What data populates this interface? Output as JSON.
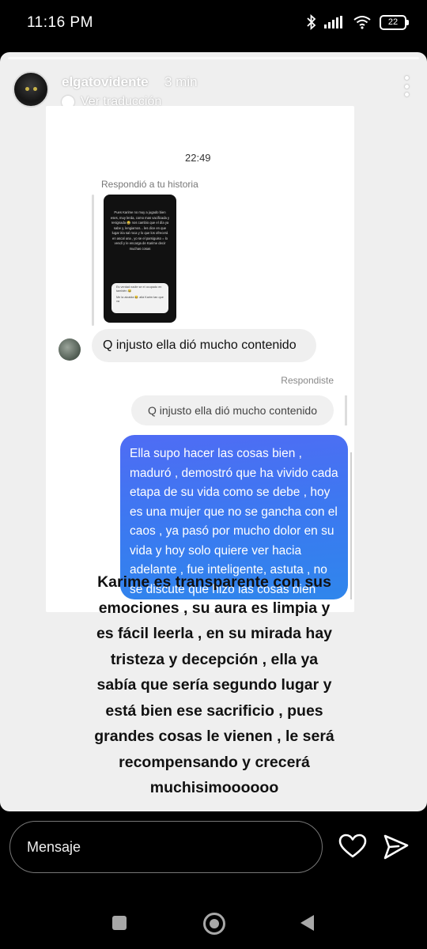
{
  "status_bar": {
    "time": "11:16 PM",
    "battery": "22"
  },
  "story": {
    "username": "elgatovidente",
    "time_ago": "3 min",
    "translate_label": "Ver traducción"
  },
  "chat": {
    "time": "22:49",
    "replied_to_story_label": "Respondió a tu historia",
    "story_thumbnail_text": "Pues Karime no muy a jugado bien eses, muy lerda, como mas vacificada y resignada 😂 nos cambio que el día ya sabe y, lengiamos... les dice en que lugar iria sal roca y lo que los ofrecerá en ascal una , yo se el parsiguiso = lo vendí y le encarga de Karime decir muchas cosas",
    "story_thumbnail_card": [
      "Es verdad nadie se el ocupado en también 😂",
      "Me la alcaida 😂 allá Karim tan que va"
    ],
    "incoming_message": "Q injusto ella dió mucho contenido",
    "you_replied_label": "Respondiste",
    "quoted_message": "Q injusto ella dió mucho contenido",
    "outgoing_message": "Ella supo hacer las cosas bien , maduró , demostró que ha vivido cada etapa de su vida como se debe , hoy es una mujer que no se gancha con el caos , ya pasó por mucho dolor en su vida y hoy solo quiere ver hacia adelante , fue inteligente, astuta , no se discute que hizo las cosas bien"
  },
  "caption": "Karime es transparente con sus emociones , su aura es limpia y es fácil leerla , en su mirada hay tristeza y decepción , ella ya sabía que sería segundo lugar y está bien ese sacrificio , pues grandes cosas le vienen , le será recompensando y crecerá muchisimoooooo",
  "message_bar": {
    "placeholder": "Mensaje"
  },
  "icons": {
    "like": "heart-icon",
    "send": "send-icon",
    "more": "more-vertical-icon"
  }
}
